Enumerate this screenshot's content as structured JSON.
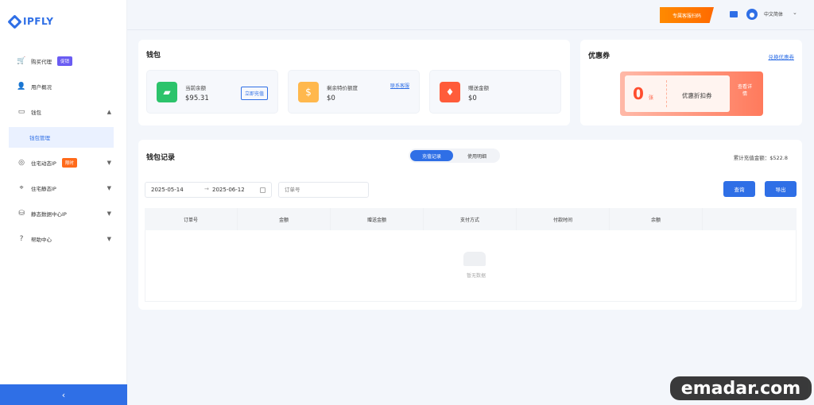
{
  "app": {
    "logo_text": "IPFLY"
  },
  "sidebar": {
    "items": [
      {
        "label": "购买代理",
        "badge": "促销",
        "icon": "cart-icon"
      },
      {
        "label": "用户概况",
        "icon": "user-icon"
      },
      {
        "label": "钱包",
        "icon": "wallet-icon"
      },
      {
        "label": "住宅动态IP",
        "badge": "限时",
        "icon": "globe-icon"
      },
      {
        "label": "住宅静态IP",
        "icon": "pin-icon"
      },
      {
        "label": "静态数据中心IP",
        "icon": "server-icon"
      },
      {
        "label": "帮助中心",
        "icon": "help-icon"
      }
    ],
    "sub_item": "钱包管理",
    "collapse": "‹"
  },
  "header": {
    "promo": "专属客服扫码",
    "language": "中文简体"
  },
  "wallet": {
    "title": "钱包",
    "tiles": [
      {
        "label": "当前余额",
        "value": "$95.31",
        "action": "立即充值"
      },
      {
        "label": "剩余特价额度",
        "value": "$0",
        "link": "联系客服"
      },
      {
        "label": "赠送金额",
        "value": "$0"
      }
    ]
  },
  "coupons": {
    "title": "优惠券",
    "link": "兑换优惠券",
    "amount": "0",
    "unit": "张",
    "name": "优惠折扣券",
    "action": "查看详情"
  },
  "records": {
    "title": "钱包记录",
    "tabs": [
      "充值记录",
      "使用明细"
    ],
    "total": "累计充值金额：$522.8",
    "date_start": "2025-05-14",
    "date_sep": "→",
    "date_end": "2025-06-12",
    "order_placeholder": "订单号",
    "btn_query": "查询",
    "btn_export": "导出",
    "columns": [
      "订单号",
      "金额",
      "赠送金额",
      "支付方式",
      "付款时间",
      "余额",
      ""
    ],
    "empty_text": "暂无数据"
  },
  "watermark": "emadar.com",
  "colors": {
    "primary": "#2f6fe6",
    "orange": "#ff6a00",
    "coupon_red": "#ff4d2e"
  }
}
